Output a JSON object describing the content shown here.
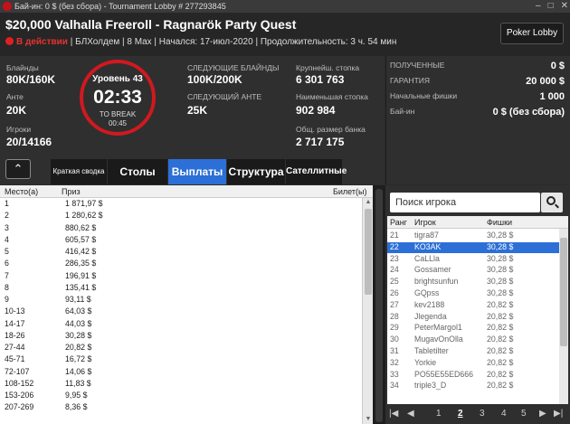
{
  "window": {
    "title": "Бай-ин: 0 $ (без сбора) - Tournament Lobby # 277293845"
  },
  "header": {
    "title": "$20,000 Valhalla Freeroll - Ragnarök Party Quest",
    "status": "В действии",
    "details": "| БЛХолдем | 8 Max | Начался: 17-июл-2020 | Продолжительность: 3 ч. 54 мин",
    "lobby_button": "Poker Lobby"
  },
  "stats": {
    "blinds_label": "Блайнды",
    "blinds": "80K/160K",
    "ante_label": "Анте",
    "ante": "20K",
    "players_label": "Игроки",
    "players": "20/14166",
    "next_blinds_label": "СЛЕДУЮЩИЕ БЛАЙНДЫ",
    "next_blinds": "100K/200K",
    "next_ante_label": "СЛЕДУЮЩИЙ АНТЕ",
    "next_ante": "25K",
    "largest_label": "Крупнейш. стопка",
    "largest": "6 301 763",
    "smallest_label": "Наименьшая стопка",
    "smallest": "902 984",
    "bank_label": "Общ. размер банка",
    "bank": "2 717 175"
  },
  "clock": {
    "level": "Уровень 43",
    "time": "02:33",
    "to_break": "TO BREAK",
    "break_time": "00:45"
  },
  "summary": {
    "received_label": "ПОЛУЧЕННЫЕ",
    "received": "0 $",
    "guarantee_label": "ГАРАНТИЯ",
    "guarantee": "20 000 $",
    "chips_label": "Начальные фишки",
    "chips": "1 000",
    "buyin_label": "Бай-ин",
    "buyin": "0 $ (без сбора)"
  },
  "tabs": [
    "Краткая сводка",
    "Столы",
    "Выплаты",
    "Структура",
    "Сателлитные"
  ],
  "payouts": {
    "columns": [
      "Место(а)",
      "Приз",
      "Билет(ы)"
    ],
    "rows": [
      [
        "1",
        "1 871,97 $"
      ],
      [
        "2",
        "1 280,62 $"
      ],
      [
        "3",
        "880,62 $"
      ],
      [
        "4",
        "605,57 $"
      ],
      [
        "5",
        "416,42 $"
      ],
      [
        "6",
        "286,35 $"
      ],
      [
        "7",
        "196,91 $"
      ],
      [
        "8",
        "135,41 $"
      ],
      [
        "9",
        "93,11 $"
      ],
      [
        "10-13",
        "64,03 $"
      ],
      [
        "14-17",
        "44,03 $"
      ],
      [
        "18-26",
        "30,28 $"
      ],
      [
        "27-44",
        "20,82 $"
      ],
      [
        "45-71",
        "16,72 $"
      ],
      [
        "72-107",
        "14,06 $"
      ],
      [
        "108-152",
        "11,83 $"
      ],
      [
        "153-206",
        "9,95 $"
      ],
      [
        "207-269",
        "8,36 $"
      ]
    ]
  },
  "players": {
    "search_placeholder": "Поиск игрока",
    "columns": [
      "Ранг",
      "Игрок",
      "Фишки"
    ],
    "selected_index": 1,
    "rows": [
      [
        "21",
        "tigra87",
        "30,28 $"
      ],
      [
        "22",
        "KO3AK",
        "30,28 $"
      ],
      [
        "23",
        "CaLLla",
        "30,28 $"
      ],
      [
        "24",
        "Gossamer",
        "30,28 $"
      ],
      [
        "25",
        "brightsunfun",
        "30,28 $"
      ],
      [
        "26",
        "GQpss",
        "30,28 $"
      ],
      [
        "27",
        "kev2188",
        "20,82 $"
      ],
      [
        "28",
        "Jlegenda",
        "20,82 $"
      ],
      [
        "29",
        "PeterMargol1",
        "20,82 $"
      ],
      [
        "30",
        "MugavOnOlla",
        "20,82 $"
      ],
      [
        "31",
        "Tabletilter",
        "20,82 $"
      ],
      [
        "32",
        "Yorkie",
        "20,82 $"
      ],
      [
        "33",
        "PO55E55ED666",
        "20,82 $"
      ],
      [
        "34",
        "triple3_D",
        "20,82 $"
      ]
    ],
    "pages": [
      "1",
      "2",
      "3",
      "4",
      "5"
    ],
    "current_page": "2"
  }
}
